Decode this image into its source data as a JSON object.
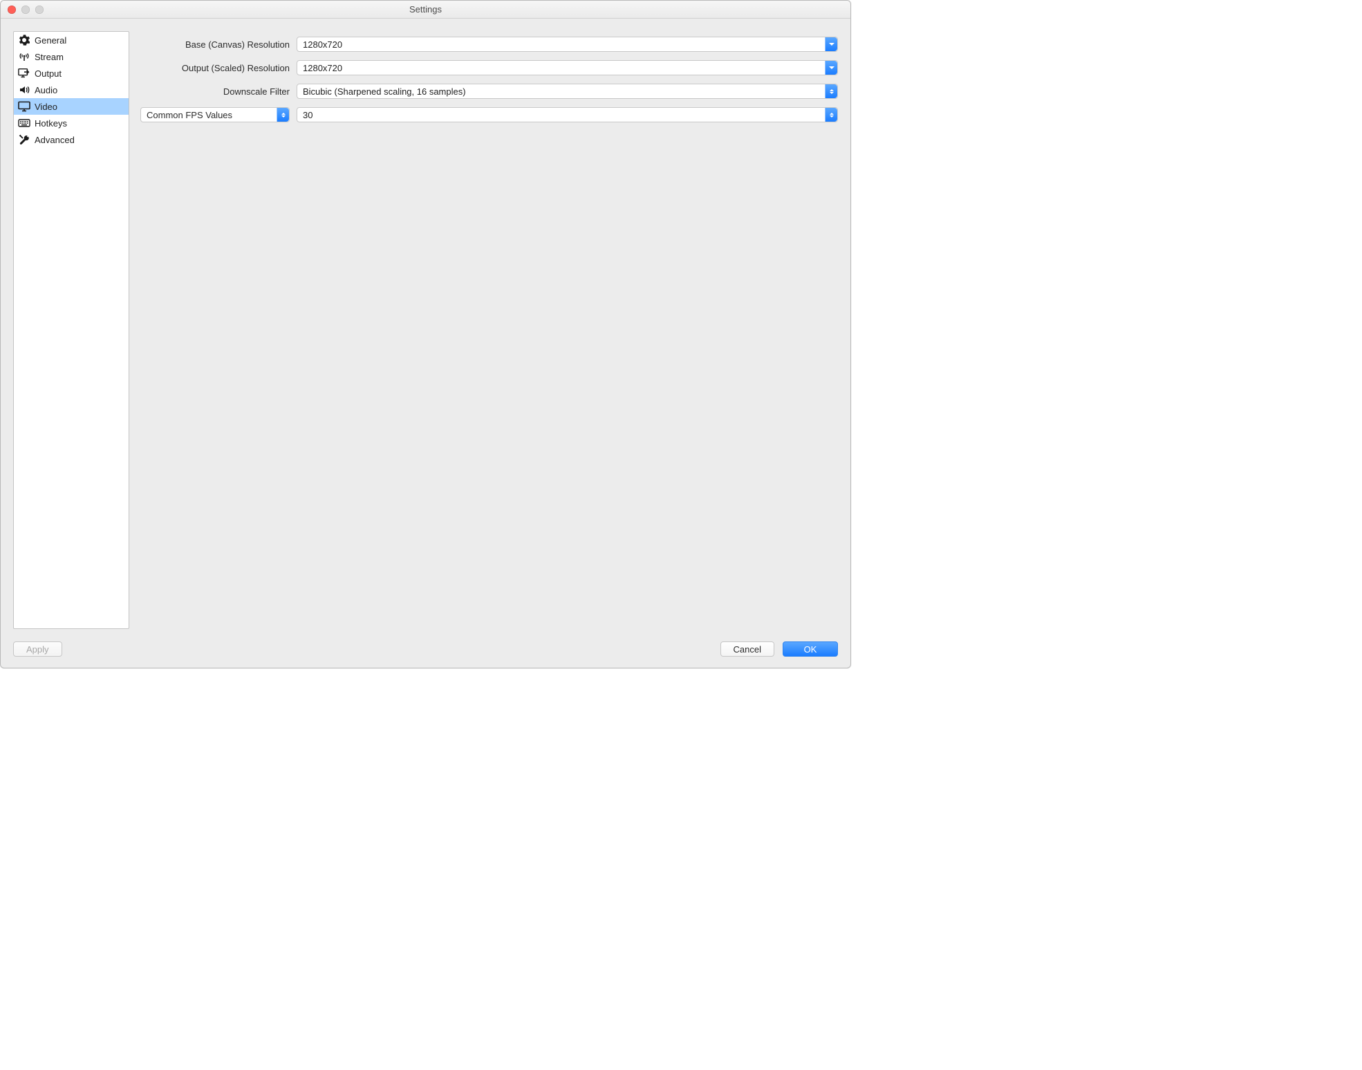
{
  "window": {
    "title": "Settings"
  },
  "sidebar": {
    "items": [
      {
        "label": "General"
      },
      {
        "label": "Stream"
      },
      {
        "label": "Output"
      },
      {
        "label": "Audio"
      },
      {
        "label": "Video"
      },
      {
        "label": "Hotkeys"
      },
      {
        "label": "Advanced"
      }
    ],
    "selected_index": 4
  },
  "video": {
    "base_resolution_label": "Base (Canvas) Resolution",
    "base_resolution_value": "1280x720",
    "output_resolution_label": "Output (Scaled) Resolution",
    "output_resolution_value": "1280x720",
    "downscale_filter_label": "Downscale Filter",
    "downscale_filter_value": "Bicubic (Sharpened scaling, 16 samples)",
    "fps_mode_value": "Common FPS Values",
    "fps_value": "30"
  },
  "buttons": {
    "apply": "Apply",
    "cancel": "Cancel",
    "ok": "OK"
  },
  "colors": {
    "accent": "#1b7dff",
    "selection": "#a8d3ff"
  }
}
